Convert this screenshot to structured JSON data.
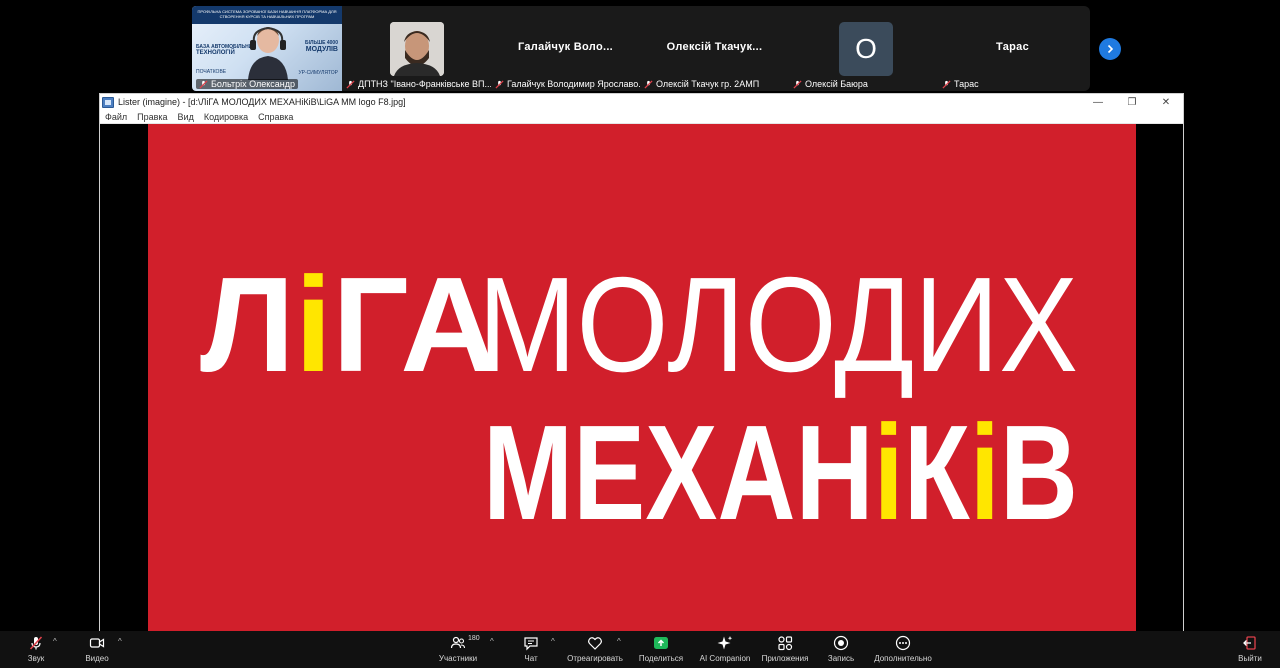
{
  "participants": {
    "tiles": [
      {
        "name": "Больтріх Олександр",
        "slide": {
          "title": "ПРОФІЛЬНА СИСТЕМА ЗОРОВАНОЇ БАЗИ НАВЧАННЯ ПЛАТФОРМА ДЛЯ СТВОРЕННЯ КУРСІВ ТА НАВЧАЛЬНИХ ПРОГРАМ",
          "left_1": "БАЗА АВТОМОБІЛЬНИХ",
          "left_2": "ТЕХНОЛОГІЙ",
          "right_1": "БІЛЬШЕ 4000",
          "right_2": "МОДУЛІВ",
          "left_3": "ПОЧАТКОВЕ",
          "right_3": "УР-СИМУЛЯТОР"
        }
      },
      {
        "name": "ДПТНЗ \"Івано-Франківське ВП..."
      },
      {
        "display_name": "Галайчук Воло...",
        "name": "Галайчук Володимир Ярославо..."
      },
      {
        "display_name": "Олексій Ткачук...",
        "name": "Олексій Ткачук гр. 2АМП"
      },
      {
        "avatar_letter": "О",
        "name": "Олексій Баюра"
      },
      {
        "display_name": "Тарас",
        "name": "Тарас"
      }
    ]
  },
  "lister": {
    "title": "Lister (imagine) - [d:\\ЛіГА МОЛОДИХ МЕХАНіКіВ\\LiGA MM logo F8.jpg]",
    "menu": [
      "Файл",
      "Правка",
      "Вид",
      "Кодировка",
      "Справка"
    ],
    "window_buttons": {
      "minimize": "—",
      "maximize": "❐",
      "close": "✕"
    }
  },
  "logo": {
    "line1_parts": [
      "Л",
      "і",
      "ГА"
    ],
    "line1_word2": "МОЛОДИХ",
    "line2_parts": [
      "МЕХАН",
      "і",
      "К",
      "і",
      "В"
    ],
    "background_color": "#d11f2b",
    "text_color": "#ffffff",
    "accent_color": "#ffe600"
  },
  "toolbar": {
    "audio": "Звук",
    "video": "Видео",
    "participants": "Участники",
    "participants_count": "180",
    "chat": "Чат",
    "react": "Отреагировать",
    "share": "Поделиться",
    "ai": "AI Companion",
    "apps": "Приложения",
    "record": "Запись",
    "more": "Дополнительно",
    "leave": "Выйти"
  }
}
